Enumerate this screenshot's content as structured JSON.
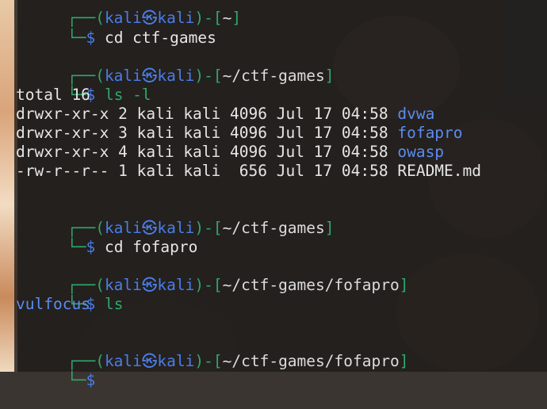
{
  "terminal": {
    "partial_prompt": "└─$",
    "lines": [
      {
        "cmd": "cd ctf-games"
      },
      {
        "prompt_user": "kali",
        "prompt_host": "kali",
        "prompt_path": "~/ctf-games",
        "cmd": "ls -l"
      },
      {
        "output": "total 16"
      },
      {
        "perm": "drwxr-xr-x 2 kali kali 4096 Jul 17 04:58 ",
        "name": "dvwa"
      },
      {
        "perm": "drwxr-xr-x 3 kali kali 4096 Jul 17 04:58 ",
        "name": "fofapro"
      },
      {
        "perm": "drwxr-xr-x 4 kali kali 4096 Jul 17 04:58 ",
        "name": "owasp"
      },
      {
        "perm": "-rw-r--r-- 1 kali kali  656 Jul 17 04:58 ",
        "name": "README.md"
      },
      {
        "prompt_user": "kali",
        "prompt_host": "kali",
        "prompt_path": "~/ctf-games",
        "cmd": "cd fofapro"
      },
      {
        "prompt_user": "kali",
        "prompt_host": "kali",
        "prompt_path": "~/ctf-games/fofapro",
        "cmd": "ls"
      },
      {
        "output": "vulfocus"
      },
      {
        "prompt_user": "kali",
        "prompt_host": "kali",
        "prompt_path": "~/ctf-games/fofapro",
        "cmd": ""
      }
    ]
  },
  "colors": {
    "prompt_frame": "#2fa86a",
    "user_host": "#4a7de8",
    "directory": "#5b8cf0",
    "text": "#e6e6e6"
  }
}
